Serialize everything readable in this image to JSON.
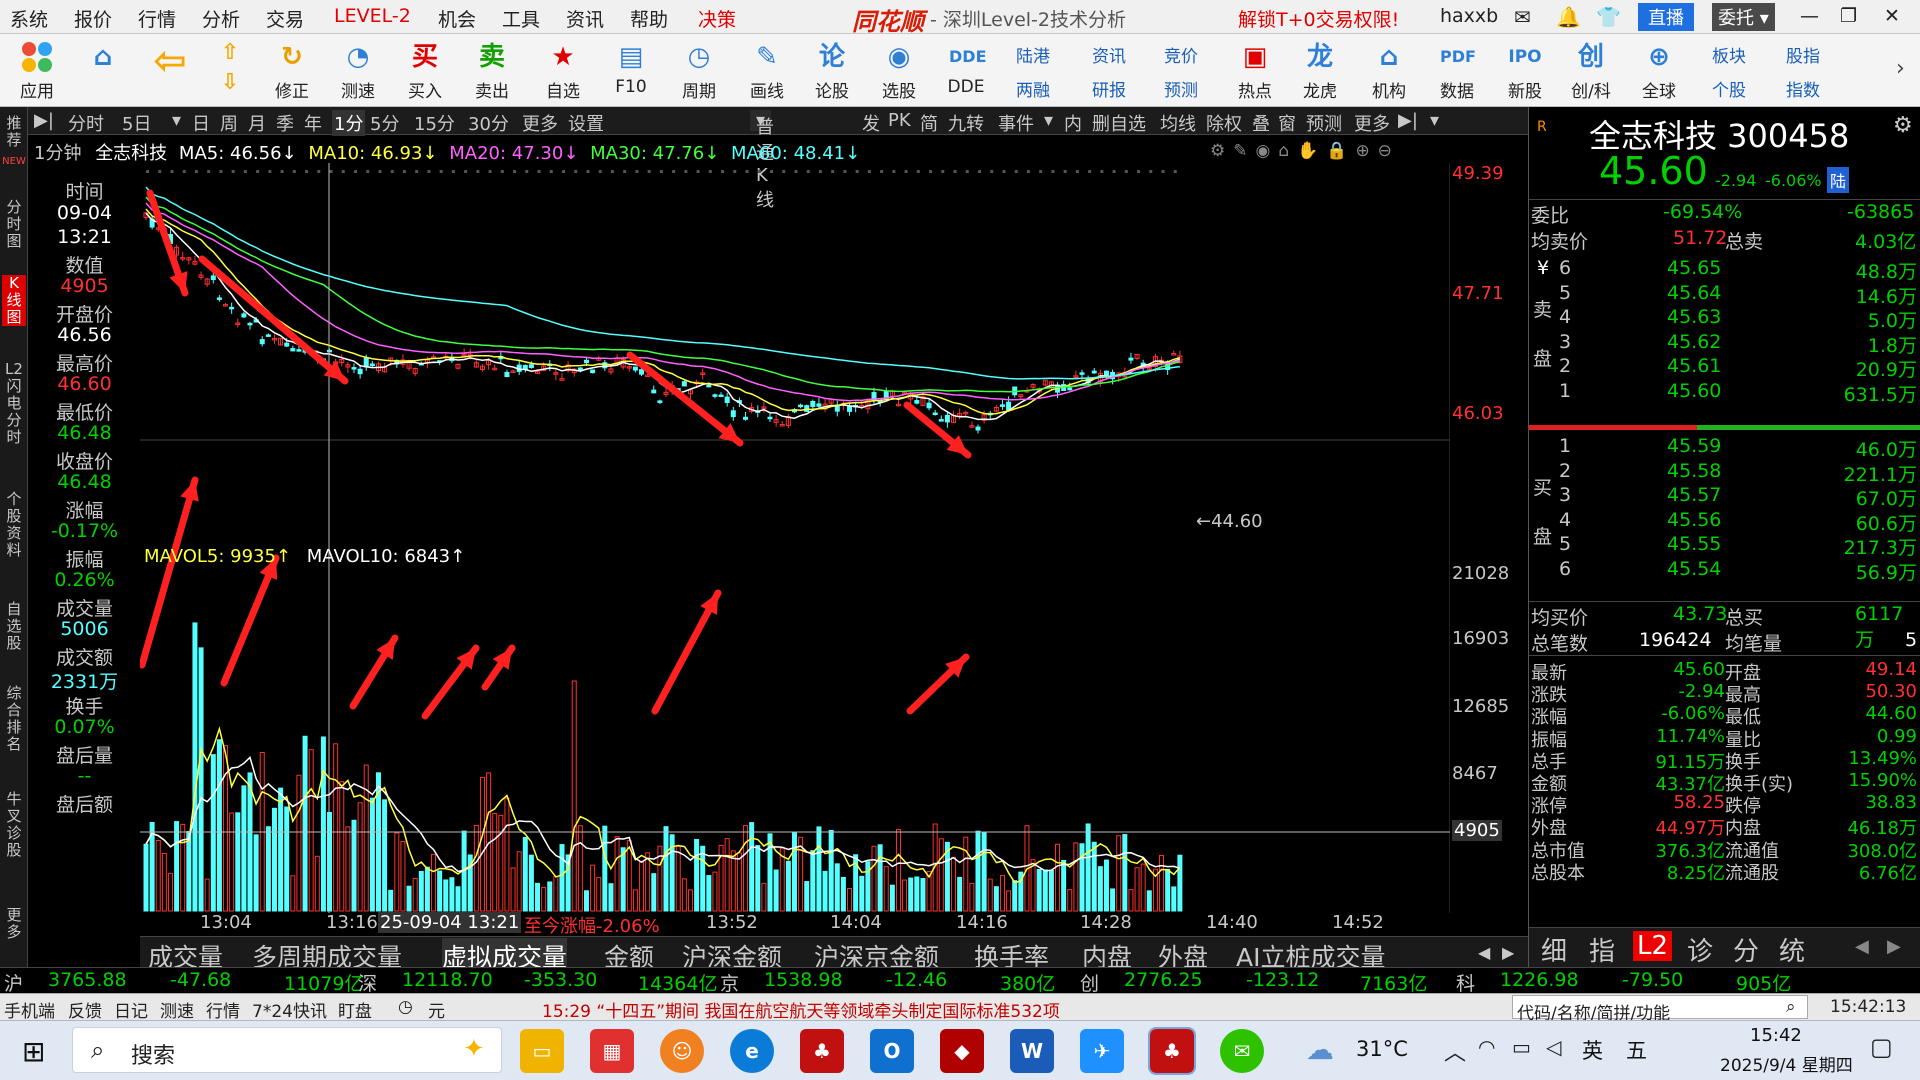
{
  "menu": {
    "items": [
      "系统",
      "报价",
      "行情",
      "分析",
      "交易",
      "LEVEL-2",
      "机会",
      "工具",
      "资讯",
      "帮助",
      "决策"
    ],
    "brand": "同花顺",
    "title": "- 深圳Level-2技术分析",
    "promo": "解锁T+0交易权限!",
    "user": "haxxb",
    "live_button": "直播",
    "entrust_button": "委托"
  },
  "toolbar": {
    "buttons": [
      "应用",
      "",
      "修正",
      "测速",
      "买入",
      "卖出",
      "自选",
      "F10",
      "周期",
      "画线",
      "论股",
      "选股",
      "DDE",
      "",
      "",
      "",
      "热点",
      "龙虎",
      "机构",
      "数据",
      "新股",
      "创/科",
      "全球",
      "",
      ""
    ],
    "icons": [
      "apps-icon",
      "home-icon",
      "back-icon",
      "fix-icon",
      "speed-icon",
      "buy-icon",
      "sell-icon",
      "watchlist-icon",
      "f10-icon",
      "period-icon",
      "draw-icon",
      "forum-icon",
      "select-icon",
      "dde-icon"
    ],
    "glyphs": [
      "买",
      "卖",
      "论",
      "DDE",
      "龙",
      "IPO",
      "创"
    ],
    "small": {
      "lugang": "陆港",
      "liangrong": "两融",
      "zixun": "资讯",
      "yanbao": "研报",
      "jingjia": "竞价",
      "yuce": "预测",
      "bankuai": "板块",
      "gegu": "个股",
      "guzhi": "股指",
      "zhishu": "指数"
    }
  },
  "left_strip": [
    "推荐",
    "分时图",
    "K线图",
    "L2闪电分时",
    "个股资料",
    "自选股",
    "综合排名",
    "牛叉诊股",
    "更多"
  ],
  "left_strip_new": "NEW",
  "chart_toolbar": {
    "items": [
      "分时",
      "5日",
      "日",
      "周",
      "月",
      "季",
      "年",
      "1分",
      "5分",
      "15分",
      "30分",
      "更多",
      "设置"
    ],
    "kline_type": "普通K线",
    "right_items": [
      "发",
      "PK",
      "简",
      "九转",
      "事件",
      "内",
      "删自选",
      "均线",
      "除权",
      "叠",
      "窗",
      "预测",
      "更多"
    ]
  },
  "ma_legend": {
    "period": "1分钟",
    "name": "全志科技",
    "ma5": "MA5: 46.56↓",
    "ma10": "MA10: 46.93↓",
    "ma20": "MA20: 47.30↓",
    "ma30": "MA30: 47.76↓",
    "ma60": "MA60: 48.41↓"
  },
  "info_panel": {
    "labels": [
      "时间",
      "09-04",
      "13:21",
      "数值",
      "4905",
      "开盘价",
      "46.56",
      "最高价",
      "46.60",
      "最低价",
      "46.48",
      "收盘价",
      "46.48",
      "涨幅",
      "-0.17%",
      "振幅",
      "0.26%",
      "成交量",
      "5006",
      "成交额",
      "2331万",
      "换手",
      "0.07%",
      "盘后量",
      "--",
      "盘后额"
    ]
  },
  "price_axis": [
    "49.39",
    "47.71",
    "46.03"
  ],
  "low_label": "44.60",
  "vol_axis": [
    "21028",
    "16903",
    "12685",
    "8467",
    "4905"
  ],
  "vol_legend": {
    "mavol5": "MAVOL5: 9935↑",
    "mavol10": "MAVOL10: 6843↑"
  },
  "time_axis": [
    "13:04",
    "13:16",
    "25-09-04 13:21",
    "至今涨幅-2.06%",
    "13:52",
    "14:04",
    "14:16",
    "14:28",
    "14:40",
    "14:52"
  ],
  "bottom_tabs": [
    "成交量",
    "多周期成交量",
    "虚拟成交量",
    "金额",
    "沪深金额",
    "沪深京金额",
    "换手率",
    "内盘",
    "外盘",
    "AI立桩成交量"
  ],
  "quote": {
    "name": "全志科技 300458",
    "price": "45.60",
    "change": "-2.94",
    "pct": "-6.06%",
    "badge": "陆",
    "weibi_label": "委比",
    "weibi": "-69.54%",
    "weicha": "-63865",
    "avg_sell_label": "均卖价",
    "avg_sell": "51.72",
    "total_sell_label": "总卖",
    "total_sell": "4.03亿",
    "sell_label": "卖盘",
    "asks": [
      {
        "lvl": "6",
        "price": "45.65",
        "vol": "48.8万"
      },
      {
        "lvl": "5",
        "price": "45.64",
        "vol": "14.6万"
      },
      {
        "lvl": "4",
        "price": "45.63",
        "vol": "5.0万"
      },
      {
        "lvl": "3",
        "price": "45.62",
        "vol": "1.8万"
      },
      {
        "lvl": "2",
        "price": "45.61",
        "vol": "20.9万"
      },
      {
        "lvl": "1",
        "price": "45.60",
        "vol": "631.5万"
      }
    ],
    "buy_label": "买盘",
    "bids": [
      {
        "lvl": "1",
        "price": "45.59",
        "vol": "46.0万"
      },
      {
        "lvl": "2",
        "price": "45.58",
        "vol": "221.1万"
      },
      {
        "lvl": "3",
        "price": "45.57",
        "vol": "67.0万"
      },
      {
        "lvl": "4",
        "price": "45.56",
        "vol": "60.6万"
      },
      {
        "lvl": "5",
        "price": "45.55",
        "vol": "217.3万"
      },
      {
        "lvl": "6",
        "price": "45.54",
        "vol": "56.9万"
      }
    ],
    "avg_buy_label": "均买价",
    "avg_buy": "43.73",
    "total_buy_label": "总买",
    "total_buy": "6117万",
    "trades_label": "总笔数",
    "trades": "196424",
    "avg_trade_label": "均笔量",
    "avg_trade": "5",
    "stats": [
      {
        "l1": "最新",
        "v1": "45.60",
        "l2": "开盘",
        "v2": "49.14",
        "c1": "#00d000",
        "c2": "#ff3030"
      },
      {
        "l1": "涨跌",
        "v1": "-2.94",
        "l2": "最高",
        "v2": "50.30",
        "c1": "#00d000",
        "c2": "#ff3030"
      },
      {
        "l1": "涨幅",
        "v1": "-6.06%",
        "l2": "最低",
        "v2": "44.60",
        "c1": "#00d000",
        "c2": "#00d000"
      },
      {
        "l1": "振幅",
        "v1": "11.74%",
        "l2": "量比",
        "v2": "0.99",
        "c1": "#00d000",
        "c2": "#00d000"
      },
      {
        "l1": "总手",
        "v1": "91.15万",
        "l2": "换手",
        "v2": "13.49%",
        "c1": "#00d000",
        "c2": "#00d000"
      },
      {
        "l1": "金额",
        "v1": "43.37亿",
        "l2": "换手(实)",
        "v2": "15.90%",
        "c1": "#00d000",
        "c2": "#00d000"
      },
      {
        "l1": "涨停",
        "v1": "58.25",
        "l2": "跌停",
        "v2": "38.83",
        "c1": "#ff3030",
        "c2": "#00d000"
      },
      {
        "l1": "外盘",
        "v1": "44.97万",
        "l2": "内盘",
        "v2": "46.18万",
        "c1": "#ff3030",
        "c2": "#00d000"
      },
      {
        "l1": "总市值",
        "v1": "376.3亿",
        "l2": "流通值",
        "v2": "308.0亿",
        "c1": "#00d000",
        "c2": "#00d000"
      },
      {
        "l1": "总股本",
        "v1": "8.25亿",
        "l2": "流通股",
        "v2": "6.76亿",
        "c1": "#00d000",
        "c2": "#00d000"
      }
    ],
    "rtabs": [
      "细",
      "指",
      "L2",
      "诊",
      "分",
      "统"
    ]
  },
  "index_bar": [
    {
      "name": "沪",
      "val": "3765.88",
      "chg": "-47.68",
      "amt": "11079亿"
    },
    {
      "name": "深",
      "val": "12118.70",
      "chg": "-353.30",
      "amt": "14364亿"
    },
    {
      "name": "京",
      "val": "1538.98",
      "chg": "-12.46",
      "amt": "380亿"
    },
    {
      "name": "创",
      "val": "2776.25",
      "chg": "-123.12",
      "amt": "7163亿"
    },
    {
      "name": "科",
      "val": "1226.98",
      "chg": "-79.50",
      "amt": "905亿"
    }
  ],
  "status": {
    "items": [
      "手机端",
      "反馈",
      "日记",
      "测速",
      "行情",
      "7*24快讯",
      "盯盘"
    ],
    "news": "15:29 “十四五”期间 我国在航空航天等领域牵头制定国际标准532项",
    "search_placeholder": "代码/名称/简拼/功能",
    "clock": "15:42:13"
  },
  "taskbar": {
    "search": "搜索",
    "weather": "31°C",
    "ime": "英",
    "time": "15:42",
    "date": "2025/9/4 星期四"
  },
  "colors": {
    "up": "#ff3030",
    "down": "#00d000",
    "cyan": "#54ffff",
    "yellow": "#ffff40",
    "white": "#ffffff",
    "bg": "#000000"
  }
}
